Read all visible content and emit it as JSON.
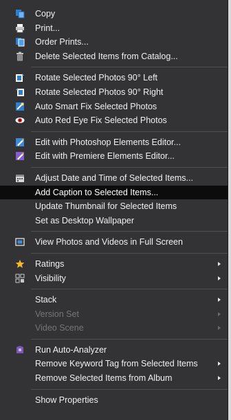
{
  "menu": {
    "items": [
      {
        "label": "Copy",
        "icon": "copy-icon"
      },
      {
        "label": "Print...",
        "icon": "printer-icon"
      },
      {
        "label": "Order Prints...",
        "icon": "order-prints-icon"
      },
      {
        "label": "Delete Selected Items from Catalog...",
        "icon": "trash-icon"
      },
      {
        "label": "Rotate Selected Photos 90° Left",
        "icon": "rotate-left-icon"
      },
      {
        "label": "Rotate Selected Photos 90° Right",
        "icon": "rotate-right-icon"
      },
      {
        "label": "Auto Smart Fix Selected Photos",
        "icon": "smart-fix-icon"
      },
      {
        "label": "Auto Red Eye Fix Selected Photos",
        "icon": "red-eye-icon"
      },
      {
        "label": "Edit with Photoshop Elements Editor...",
        "icon": "photoshop-elements-icon"
      },
      {
        "label": "Edit with Premiere Elements Editor...",
        "icon": "premiere-elements-icon"
      },
      {
        "label": "Adjust Date and Time of Selected Items...",
        "icon": "calendar-icon"
      },
      {
        "label": "Add Caption to Selected Items..."
      },
      {
        "label": "Update Thumbnail for Selected Items"
      },
      {
        "label": "Set as Desktop Wallpaper"
      },
      {
        "label": "View Photos and Videos in Full Screen",
        "icon": "full-screen-icon"
      },
      {
        "label": "Ratings",
        "icon": "star-icon"
      },
      {
        "label": "Visibility",
        "icon": "visibility-icon"
      },
      {
        "label": "Stack"
      },
      {
        "label": "Version Set"
      },
      {
        "label": "Video Scene"
      },
      {
        "label": "Run Auto-Analyzer",
        "icon": "auto-analyzer-icon"
      },
      {
        "label": "Remove Keyword Tag from Selected Items"
      },
      {
        "label": "Remove Selected Items from Album"
      },
      {
        "label": "Show Properties"
      }
    ]
  },
  "colors": {
    "menu_bg": "#333336",
    "text": "#f0f0f0",
    "disabled_text": "#76767a",
    "highlight_bg": "#0c0c0c",
    "separator": "#4f4f53"
  }
}
